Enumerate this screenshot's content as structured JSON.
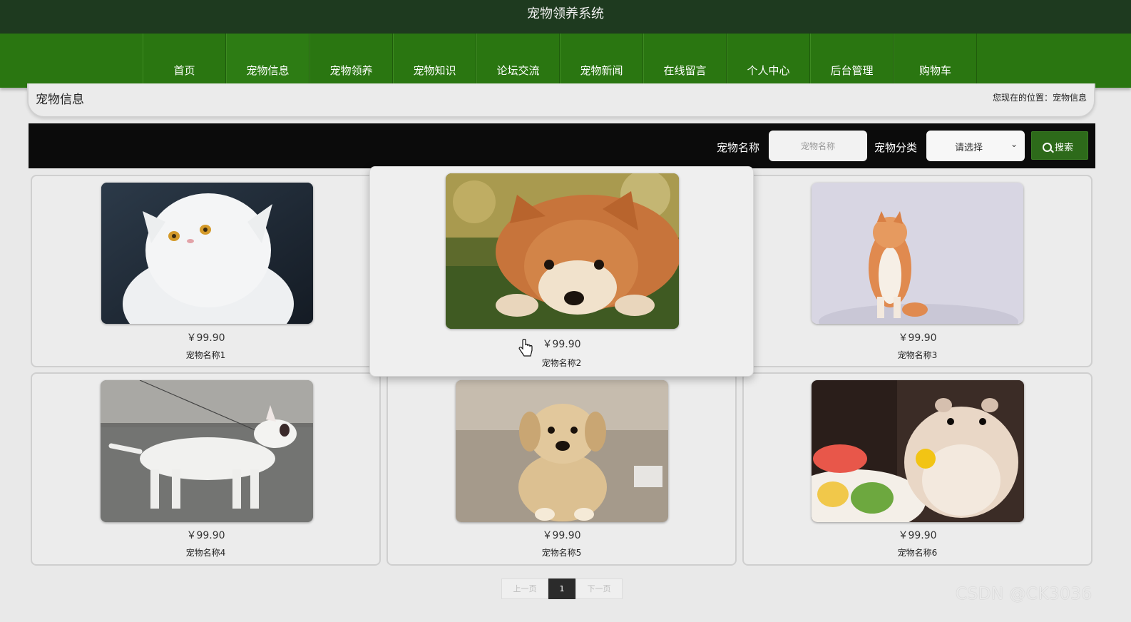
{
  "header": {
    "title": "宠物领养系统"
  },
  "nav": {
    "items": [
      {
        "label": "首页"
      },
      {
        "label": "宠物信息"
      },
      {
        "label": "宠物领养"
      },
      {
        "label": "宠物知识"
      },
      {
        "label": "论坛交流"
      },
      {
        "label": "宠物新闻"
      },
      {
        "label": "在线留言"
      },
      {
        "label": "个人中心"
      },
      {
        "label": "后台管理"
      },
      {
        "label": "购物车"
      }
    ]
  },
  "breadcrumb": {
    "title": "宠物信息",
    "position": "您现在的位置：宠物信息"
  },
  "search": {
    "name_label": "宠物名称",
    "name_placeholder": "宠物名称",
    "category_label": "宠物分类",
    "category_selected": "请选择",
    "button_label": "搜索"
  },
  "products": [
    {
      "price": "￥99.90",
      "name": "宠物名称1",
      "image": "white-persian-cat"
    },
    {
      "price": "￥99.90",
      "name": "宠物名称2",
      "image": "shiba-dog-lying"
    },
    {
      "price": "￥99.90",
      "name": "宠物名称3",
      "image": "orange-cat-sitting"
    },
    {
      "price": "￥99.90",
      "name": "宠物名称4",
      "image": "bull-terrier"
    },
    {
      "price": "￥99.90",
      "name": "宠物名称5",
      "image": "labrador-puppy"
    },
    {
      "price": "￥99.90",
      "name": "宠物名称6",
      "image": "hamster-eating"
    }
  ],
  "pagination": {
    "prev": "上一页",
    "current": "1",
    "next": "下一页"
  },
  "watermark": "CSDN @CK3036"
}
